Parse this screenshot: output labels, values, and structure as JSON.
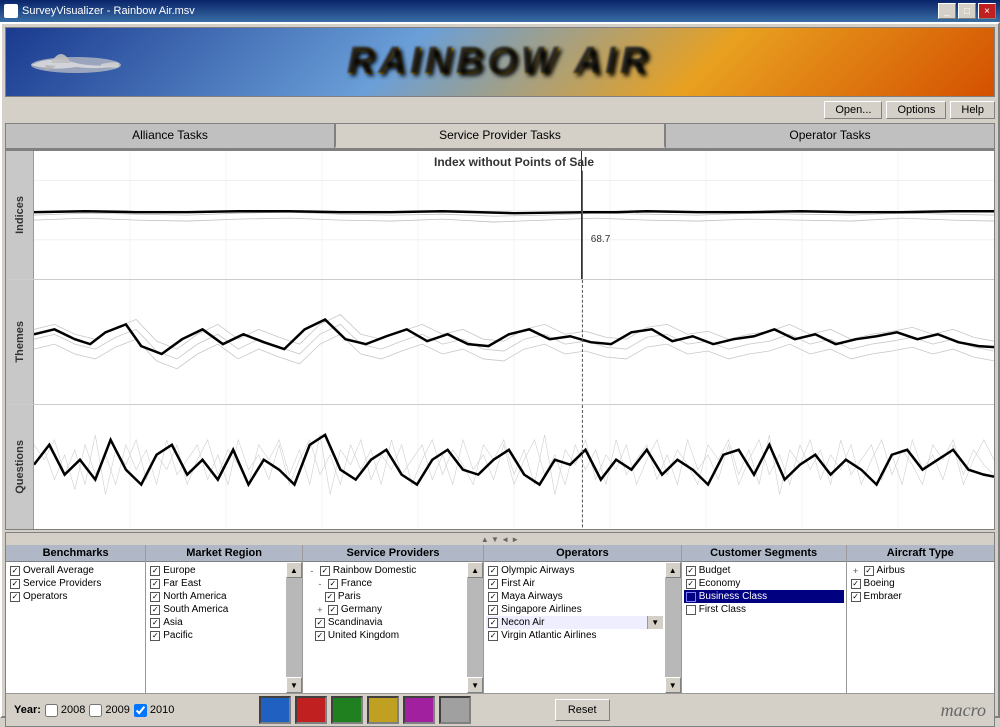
{
  "window": {
    "title": "SurveyVisualizer - Rainbow Air.msv",
    "buttons": [
      "_",
      "□",
      "×"
    ]
  },
  "banner": {
    "title": "RAINBOW AIR"
  },
  "toolbar": {
    "open": "Open...",
    "options": "Options",
    "help": "Help"
  },
  "tabs": [
    {
      "label": "Alliance Tasks",
      "active": false
    },
    {
      "label": "Service Provider Tasks",
      "active": true
    },
    {
      "label": "Operator Tasks",
      "active": false
    }
  ],
  "chart": {
    "title": "Index without Points of Sale",
    "crosshair_value": "68.7",
    "sections": [
      "Indices",
      "Themes",
      "Questions"
    ]
  },
  "filters": {
    "benchmarks": {
      "header": "Benchmarks",
      "items": [
        {
          "label": "Overall Average",
          "indent": 0,
          "checked": true
        },
        {
          "label": "Service Providers",
          "indent": 0,
          "checked": true
        },
        {
          "label": "Operators",
          "indent": 0,
          "checked": true
        }
      ]
    },
    "market_region": {
      "header": "Market Region",
      "items": [
        {
          "label": "Europe",
          "indent": 0,
          "checked": true
        },
        {
          "label": "Far East",
          "indent": 0,
          "checked": true
        },
        {
          "label": "North America",
          "indent": 0,
          "checked": true,
          "highlighted": false
        },
        {
          "label": "South America",
          "indent": 0,
          "checked": true
        },
        {
          "label": "Asia",
          "indent": 0,
          "checked": true
        },
        {
          "label": "Pacific",
          "indent": 0,
          "checked": true
        }
      ]
    },
    "service_providers": {
      "header": "Service Providers",
      "items": [
        {
          "label": "Rainbow Domestic",
          "indent": 0,
          "checked": true,
          "expand": "-"
        },
        {
          "label": "France",
          "indent": 1,
          "checked": true,
          "expand": "-"
        },
        {
          "label": "Paris",
          "indent": 2,
          "checked": true
        },
        {
          "label": "Germany",
          "indent": 1,
          "checked": true,
          "expand": "+"
        },
        {
          "label": "Scandinavia",
          "indent": 1,
          "checked": true
        },
        {
          "label": "United Kingdom",
          "indent": 1,
          "checked": true
        }
      ]
    },
    "operators": {
      "header": "Operators",
      "items": [
        {
          "label": "Olympic Airways",
          "indent": 0,
          "checked": true
        },
        {
          "label": "First Air",
          "indent": 0,
          "checked": true
        },
        {
          "label": "Maya Airways",
          "indent": 0,
          "checked": true
        },
        {
          "label": "Singapore Airlines",
          "indent": 0,
          "checked": true
        },
        {
          "label": "Necon Air",
          "indent": 0,
          "checked": true
        },
        {
          "label": "Virgin Atlantic Airlines",
          "indent": 0,
          "checked": true
        }
      ]
    },
    "customer_segments": {
      "header": "Customer Segments",
      "items": [
        {
          "label": "Budget",
          "indent": 0,
          "checked": true
        },
        {
          "label": "Economy",
          "indent": 0,
          "checked": true
        },
        {
          "label": "Business Class",
          "indent": 0,
          "checked": true,
          "selected": true
        },
        {
          "label": "First Class",
          "indent": 0,
          "checked": false
        }
      ]
    },
    "aircraft_type": {
      "header": "Aircraft Type",
      "items": [
        {
          "label": "Airbus",
          "indent": 0,
          "checked": true,
          "expand": "+"
        },
        {
          "label": "Boeing",
          "indent": 0,
          "checked": true
        },
        {
          "label": "Embraer",
          "indent": 0,
          "checked": true
        }
      ]
    }
  },
  "years": [
    {
      "label": "2008",
      "checked": false
    },
    {
      "label": "2009",
      "checked": false
    },
    {
      "label": "2010",
      "checked": true
    }
  ],
  "colors": [
    {
      "name": "blue",
      "hex": "#2060c0"
    },
    {
      "name": "red",
      "hex": "#c02020"
    },
    {
      "name": "green",
      "hex": "#208020"
    },
    {
      "name": "yellow",
      "hex": "#c0a020"
    },
    {
      "name": "purple",
      "hex": "#a020a0"
    },
    {
      "name": "gray",
      "hex": "#a0a0a0"
    }
  ],
  "reset_button": "Reset",
  "macro_logo": "macro"
}
